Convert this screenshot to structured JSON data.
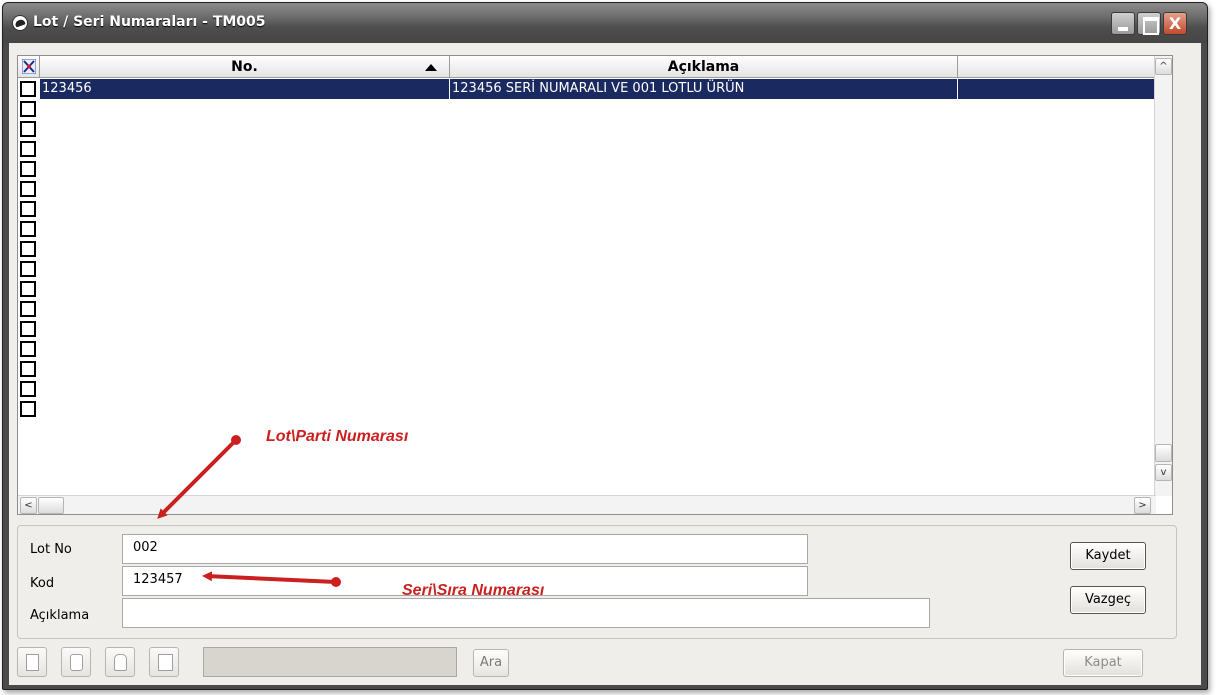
{
  "window": {
    "title": "Lot / Seri Numaraları - TM005",
    "close_glyph": "X"
  },
  "grid": {
    "columns": [
      "No.",
      "Açıklama"
    ],
    "rows": [
      {
        "no": "123456",
        "aciklama": "123456 SERİ NUMARALI VE 001 LOTLU ÜRÜN",
        "selected": true
      }
    ],
    "empty_row_count": 16,
    "scroll": {
      "up": "^",
      "down": "v",
      "left": "<",
      "right": ">"
    }
  },
  "form": {
    "lot_no_label": "Lot No",
    "lot_no_value": "002",
    "kod_label": "Kod",
    "kod_value": "123457",
    "aciklama_label": "Açıklama",
    "aciklama_value": ""
  },
  "buttons": {
    "kaydet": "Kaydet",
    "vazgec": "Vazgeç",
    "ara": "Ara",
    "kapat": "Kapat"
  },
  "annotations": {
    "lot_parti": "Lot\\Parti Numarası",
    "seri_sira": "Seri\\Sıra Numarası"
  },
  "colors": {
    "selection": "#1a2a60",
    "annotation": "#cc1f1f"
  },
  "icons": [
    "new-icon",
    "print-icon",
    "delete-icon",
    "list-icon"
  ]
}
